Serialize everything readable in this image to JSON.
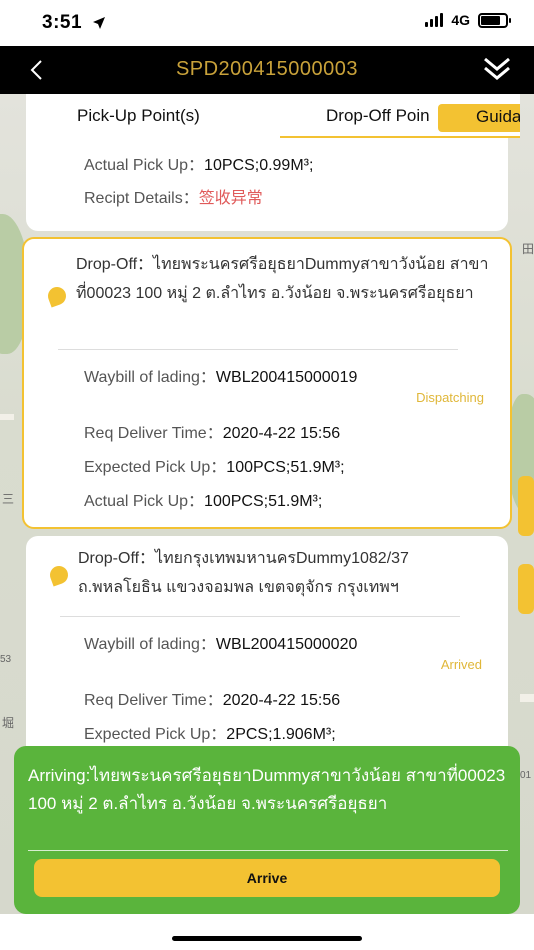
{
  "status_bar": {
    "time": "3:51",
    "network": "4G"
  },
  "nav": {
    "title": "SPD200415000003"
  },
  "tabs": [
    {
      "label": "Pick-Up Point(s)"
    },
    {
      "label": "Drop-Off Poin"
    }
  ],
  "guide_label": "Guidar",
  "card1": {
    "actual_label": "Actual Pick Up：",
    "actual_value": "10PCS;0.99M³;",
    "receipt_label": "Recipt Details：",
    "receipt_value": "签收异常"
  },
  "card2": {
    "drop_off": "Drop-Off：ไทยพระนครศรีอยุธยาDummyสาขาวังน้อย สาขาที่00023 100 หมู่ 2 ต.ลำไทร อ.วังน้อย จ.พระนครศรีอยุธยา",
    "waybill_label": "Waybill of lading：",
    "waybill_value": "WBL200415000019",
    "status": "Dispatching",
    "req_label": "Req Deliver Time：",
    "req_value": "2020-4-22 15:56",
    "expected_label": "Expected Pick Up：",
    "expected_value": "100PCS;51.9M³;",
    "actual_label": "Actual Pick Up：",
    "actual_value": "100PCS;51.9M³;"
  },
  "card3": {
    "drop_off": "Drop-Off：ไทยกรุงเทพมหานครDummy1082/37 ถ.พหลโยธิน แขวงจอมพล เขตจตุจักร กรุงเทพฯ",
    "waybill_label": "Waybill of lading：",
    "waybill_value": "WBL200415000020",
    "status": "Arrived",
    "req_label": "Req Deliver Time：",
    "req_value": "2020-4-22 15:56",
    "expected_label": "Expected Pick Up：",
    "expected_value": "2PCS;1.906M³;"
  },
  "arriving": {
    "text": "Arriving:ไทยพระนครศรีอยุธยาDummyสาขาวังน้อย สาขาที่00023 100 หมู่ 2 ต.ลำไทร อ.วังน้อย จ.พระนครศรีอยุธยา",
    "button": "Arrive"
  },
  "map": {
    "label_1": "田",
    "label_2": "三",
    "label_3": "53",
    "label_4": "堀",
    "label_5": "01"
  },
  "colors": {
    "accent": "#f3c232",
    "nav_bg": "#000000",
    "title": "#c9a23a",
    "arrive_bg": "#5ab43c",
    "error": "#e05a5a"
  }
}
